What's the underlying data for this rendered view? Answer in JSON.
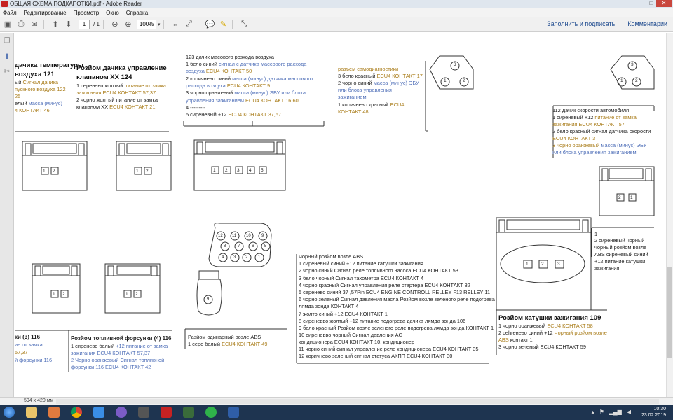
{
  "window": {
    "title": "ОБЩАЯ СХЕМА ПОДКАПОТКИ.pdf - Adobe Reader",
    "min": "_",
    "max": "□",
    "close": "✕"
  },
  "menu": [
    "Файл",
    "Редактирование",
    "Просмотр",
    "Окно",
    "Справка"
  ],
  "toolbar": {
    "page_current": "1",
    "page_total": "/ 1",
    "zoom": "100%",
    "fill_sign": "Заполнить и подписать",
    "comments": "Комментарии"
  },
  "status": {
    "page_size": "594 x 420 мм"
  },
  "clock": {
    "time": "10:30",
    "date": "23.02.2019"
  },
  "doc": {
    "b1": {
      "title1": "дачика температуры",
      "title2": "воздуха 121",
      "l1a": "ый ",
      "l1b": "Сигнал дачика",
      "l2": "пускного воздуха 122",
      "l3": "25",
      "l4a": "елый ",
      "l4b": "масса (минус)",
      "l5": "4 КОНТАКТ 46"
    },
    "b2": {
      "title1": "Розйом дачика управление",
      "title2": "клапаном ХХ 124",
      "l1a": "1 серенево жолтый ",
      "l1b": "питание от замка",
      "l2": "зажигания ECU4 КОНТАКТ 57,37",
      "l3": " 2 чорно жолтый питание от замка",
      "l4a": "клапаном ХХ ",
      "l4b": "ECU4 КОНТАКТ 21"
    },
    "b3": {
      "title": "123 дачик масового розхода воздуха",
      "l1a": "1 бело синий ",
      "l1b": "сигнал с датчика массового расхода",
      "l2a": "воздуха ",
      "l2b": "ECU4 КОНТАКТ 50",
      "l3a": "2 коричнево синий  ",
      "l3b": "масса (минус) датчика массового",
      "l4a": "расхода воздуха ",
      "l4b": "ECU4 КОНТАКТ 9",
      "l5a": "3 чорно оранжевый ",
      "l5b": "масса (минус) ЭБУ или блока",
      "l6a": "управления зажиганием ",
      "l6b": "ECU4 КОНТАКТ 16,60",
      "l7": "4 ---------",
      "l8a": "5 сиреневый +12 ",
      "l8b": "ECU4 КОНТАКТ 37,57"
    },
    "b4": {
      "title": "разъем самодиагностики",
      "l1a": "3 бело красный ",
      "l1b": "ECU4 КОНТАКТ 17",
      "l2a": "2 чорно синий ",
      "l2b": "масса (минус) ЭБУ",
      "l3": "или блока управления",
      "l4": "зажиганием",
      "l5a": "1 коричнево красный ",
      "l5b": "ECU4",
      "l6": "КОНТАКТ 48"
    },
    "b5": {
      "title": "112 дачик скорости автомобиля",
      "l1a": "1 сиреневый +12  ",
      "l1b": "питание от замка",
      "l2a": "зажигания   ",
      "l2b": "ECU4 КОНТАКТ 57",
      "l3a": "2 бело красный ",
      "l3b": "сигнал датчика скорости",
      "l4": "ECU4 КОНТАКТ 3",
      "l5a": "3 чорно оранжевый ",
      "l5b": "масса (минус) ЭБУ",
      "l6": "или блока управления зажиганием"
    },
    "b6": {
      "l1": "1",
      "l2": " 2 сиреневый чорный",
      "l3": "чорный розйом возле",
      "l4": "ABS сиреневый синий",
      "l5": "+12 питание катушки",
      "l6": "зажигания"
    },
    "abs": {
      "title": "Чорный розйом возле ABS",
      "lines": [
        "1 сиреневый синий  +12 питание катушки зажигания",
        "2 чорно  синий Сигнал  реле топливного насоса ECU4 КОНТАКТ 53",
        "3 бело чорный Сигнал тахометра ECU4 КОНТАКТ 4",
        "4 чорно красный Сигнал управления реле стартера ECU4 КОНТАКТ 32",
        "5 серенево синий 37 ,57Pin ECU4 ENGINE CONTROLL RELLEY F13 RELLEY 11",
        "6 чорно зеленый Сигнал давления масла Розйом возле зеленого реле подогрева",
        "лямда зонда КОНТАКТ 4",
        "7 жолто синий  +12 ECU4 КОНТАКТ 1",
        "8 сиреневво жолтый +12 питание подогрева дачика лямда зонда 106",
        "9 бело красный Розйом возле зеленого реле подогрева лямда зонда КОНТАКТ 1",
        "10 сиреневво чорный Сигнал давления АС",
        "кондиционера ECU4 КОНТАКТ 10. кондиционер",
        "11 чорно синий  сигнал управление реле кондиционера ECU4 КОНТАКТ 35",
        "12 коричнево зеленый сигнал статуса АКПП  ECU4 КОНТАКТ 30"
      ]
    },
    "abs_single": {
      "title": "Разйом одинарный возле ABS",
      "l1a": "1 серо белый ",
      "l1b": "ECU4 КОНТАКТ 49"
    },
    "b7": {
      "title": "ки (3) 116",
      "l1": "ие от замка",
      "l2": "57,37",
      "l3": "й форсунки 116"
    },
    "b8": {
      "title": "Розйом топливной форсунки (4) 116",
      "l1a": "1 сиренево белый  ",
      "l1b": "+12 питание от замка",
      "l2": "зажигания ECU4 КОНТАКТ 57,37",
      "l3a": "2 Чорно оранжевый ",
      "l3b": "Сигнал  топливной",
      "l4": "форсунки 116 ECU4 КОНТАКТ 42"
    },
    "coil": {
      "title": "Розйом катушки зажигания 109",
      "l1a": "1 чорно оранжевый ",
      "l1b": "ECU4 КОНТАКТ  58",
      "l2a": "2 сеhreнево синий +12 ",
      "l2b": "Чорный розйом возле",
      "l3a": "ABS ",
      "l3b": "контакт 1",
      "l4": "3 чорно зеленый ECU4 КОНТАКТ 59"
    },
    "pins": {
      "p1": "1",
      "p2": "2",
      "p3": "3",
      "p4": "4",
      "p5": "5",
      "p6": "6",
      "p7": "7",
      "p8": "8",
      "p9": "9",
      "p10": "10",
      "p11": "11",
      "p12": "12"
    }
  }
}
